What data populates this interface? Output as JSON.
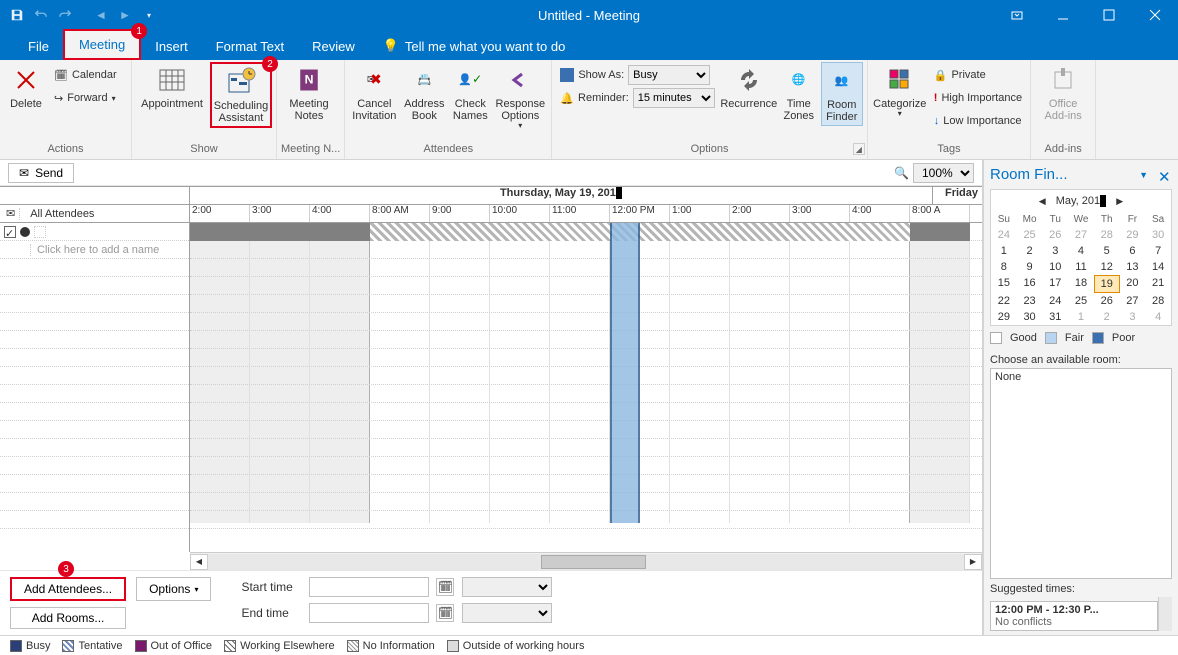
{
  "window": {
    "title": "Untitled - Meeting"
  },
  "tabs": {
    "file": "File",
    "meeting": "Meeting",
    "insert": "Insert",
    "format_text": "Format Text",
    "review": "Review",
    "tell_me": "Tell me what you want to do"
  },
  "badges": {
    "b1": "1",
    "b2": "2",
    "b3": "3"
  },
  "ribbon": {
    "actions": {
      "label": "Actions",
      "delete": "Delete",
      "calendar": "Calendar",
      "forward": "Forward"
    },
    "show": {
      "label": "Show",
      "appointment": "Appointment",
      "scheduling": "Scheduling Assistant"
    },
    "meeting_notes": {
      "label": "Meeting N...",
      "btn": "Meeting Notes"
    },
    "attendees": {
      "label": "Attendees",
      "cancel": "Cancel Invitation",
      "address": "Address Book",
      "check": "Check Names",
      "response": "Response Options"
    },
    "options": {
      "label": "Options",
      "show_as_lbl": "Show As:",
      "show_as_val": "Busy",
      "reminder_lbl": "Reminder:",
      "reminder_val": "15 minutes",
      "recurrence": "Recurrence",
      "time_zones": "Time Zones",
      "room_finder": "Room Finder"
    },
    "tags": {
      "label": "Tags",
      "categorize": "Categorize",
      "private": "Private",
      "high": "High Importance",
      "low": "Low Importance"
    },
    "addins": {
      "label": "Add-ins",
      "office": "Office Add-ins"
    }
  },
  "scheduling": {
    "send": "Send",
    "zoom": "100%",
    "date_header": "Thursday, May 19, 201",
    "next_day": "Friday",
    "time_labels": [
      "2:00",
      "3:00",
      "4:00",
      "8:00 AM",
      "9:00",
      "10:00",
      "11:00",
      "12:00 PM",
      "1:00",
      "2:00",
      "3:00",
      "4:00",
      "8:00 A"
    ],
    "all_attendees": "All Attendees",
    "add_name_ph": "Click here to add a name",
    "add_attendees": "Add Attendees...",
    "add_rooms": "Add Rooms...",
    "options_btn": "Options",
    "start_time": "Start time",
    "end_time": "End time"
  },
  "legend": {
    "busy": "Busy",
    "tentative": "Tentative",
    "oof": "Out of Office",
    "elsewhere": "Working Elsewhere",
    "noinfo": "No Information",
    "outside": "Outside of working hours"
  },
  "roomfinder": {
    "title": "Room Fin...",
    "month": "May, 201",
    "dow": [
      "Su",
      "Mo",
      "Tu",
      "We",
      "Th",
      "Fr",
      "Sa"
    ],
    "days": [
      {
        "d": 24,
        "g": 1
      },
      {
        "d": 25,
        "g": 1
      },
      {
        "d": 26,
        "g": 1
      },
      {
        "d": 27,
        "g": 1
      },
      {
        "d": 28,
        "g": 1
      },
      {
        "d": 29,
        "g": 1
      },
      {
        "d": 30,
        "g": 1
      },
      {
        "d": 1
      },
      {
        "d": 2
      },
      {
        "d": 3
      },
      {
        "d": 4
      },
      {
        "d": 5
      },
      {
        "d": 6
      },
      {
        "d": 7
      },
      {
        "d": 8
      },
      {
        "d": 9
      },
      {
        "d": 10
      },
      {
        "d": 11
      },
      {
        "d": 12
      },
      {
        "d": 13
      },
      {
        "d": 14
      },
      {
        "d": 15
      },
      {
        "d": 16
      },
      {
        "d": 17
      },
      {
        "d": 18
      },
      {
        "d": 19,
        "t": 1
      },
      {
        "d": 20
      },
      {
        "d": 21
      },
      {
        "d": 22
      },
      {
        "d": 23
      },
      {
        "d": 24
      },
      {
        "d": 25
      },
      {
        "d": 26
      },
      {
        "d": 27
      },
      {
        "d": 28
      },
      {
        "d": 29
      },
      {
        "d": 30
      },
      {
        "d": 31
      },
      {
        "d": 1,
        "g": 1
      },
      {
        "d": 2,
        "g": 1
      },
      {
        "d": 3,
        "g": 1
      },
      {
        "d": 4,
        "g": 1
      }
    ],
    "good": "Good",
    "fair": "Fair",
    "poor": "Poor",
    "choose": "Choose an available room:",
    "room_none": "None",
    "suggested_lbl": "Suggested times:",
    "suggested_time": "12:00 PM - 12:30 P...",
    "suggested_conf": "No conflicts"
  }
}
